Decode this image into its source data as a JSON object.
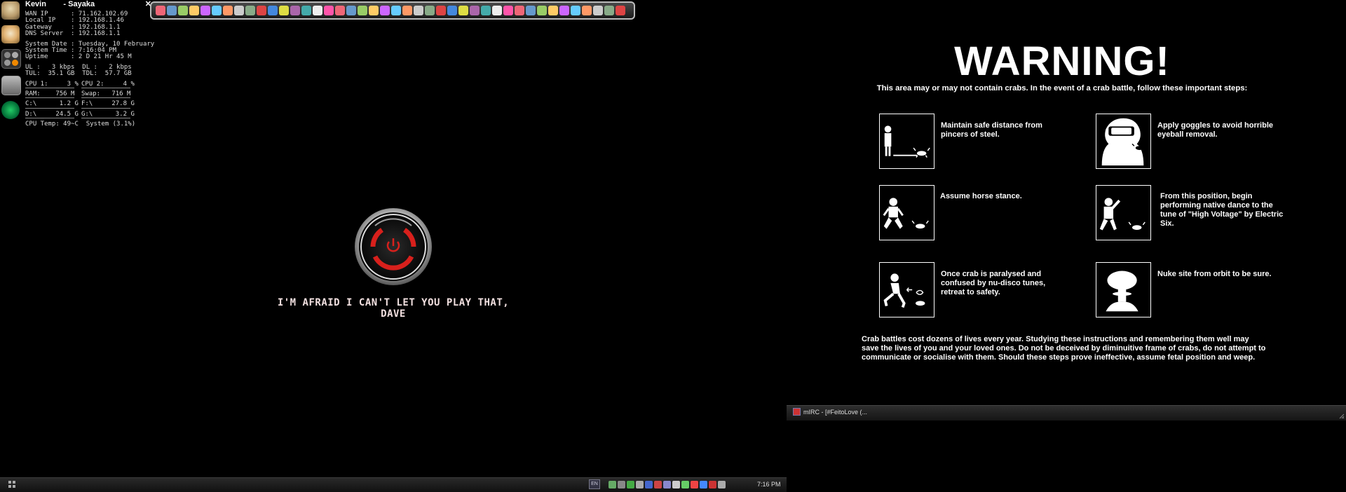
{
  "sysmon": {
    "user_left": "Kevin",
    "user_right": "- Sayaka",
    "close_glyph": "✕",
    "lines": [
      "WAN IP      : 71.162.102.69",
      "Local IP    : 192.168.1.46",
      "Gateway     : 192.168.1.1",
      "DNS Server  : 192.168.1.1"
    ],
    "time_lines": [
      "System Date : Tuesday, 10 February",
      "System Time : 7:16:04 PM",
      "Uptime      : 2 D 21 Hr 45 M"
    ],
    "net_lines": [
      "UL :   3 kbps  DL :   2 kbps",
      "TUL:  35.1 GB  TDL:  57.7 GB"
    ],
    "stats": [
      [
        "CPU 1:     3 %",
        "CPU 2:     4 %"
      ],
      [
        "RAM:    756 M",
        "Swap:   716 M"
      ],
      [
        "C:\\      1.2 G",
        "F:\\     27.8 G"
      ],
      [
        "D:\\     24.5 G",
        "G:\\      3.2 G"
      ]
    ],
    "footer": "CPU Temp: 49~C  System (3.1%)"
  },
  "hal": {
    "caption": "I'M AFRAID I CAN'T LET YOU PLAY THAT, DAVE"
  },
  "taskbar": {
    "language": "EN",
    "clock": "7:16 PM"
  },
  "warning": {
    "title": "WARNING!",
    "subtitle": "This area may or may not contain crabs. In the event of a crab battle, follow these important steps:",
    "steps": [
      "Maintain safe distance from pincers of steel.",
      "Apply goggles to avoid horrible eyeball removal.",
      "Assume horse stance.",
      "From this position, begin performing native dance to the tune of \"High Voltage\" by Electric Six.",
      "Once crab is paralysed and confused by nu-disco tunes, retreat to safety.",
      "Nuke site from orbit to be sure."
    ],
    "footer": "Crab battles cost dozens of lives every year. Studying these instructions and remembering them well may save the lives of you and your loved ones. Do not be deceived by diminuitive frame of crabs, do not attempt to communicate or socialise with them. Should these steps prove ineffective, assume fetal position and weep."
  },
  "mirc": {
    "label": "mIRC - [#FeitoLove (..."
  },
  "colors": {
    "hal_red": "#d8201c",
    "background": "#000000",
    "text": "#ffffff"
  },
  "icons": {
    "dock": [
      "avatar-icon",
      "cat-icon",
      "apps-icon",
      "folder-icon",
      "swirl-icon"
    ]
  }
}
